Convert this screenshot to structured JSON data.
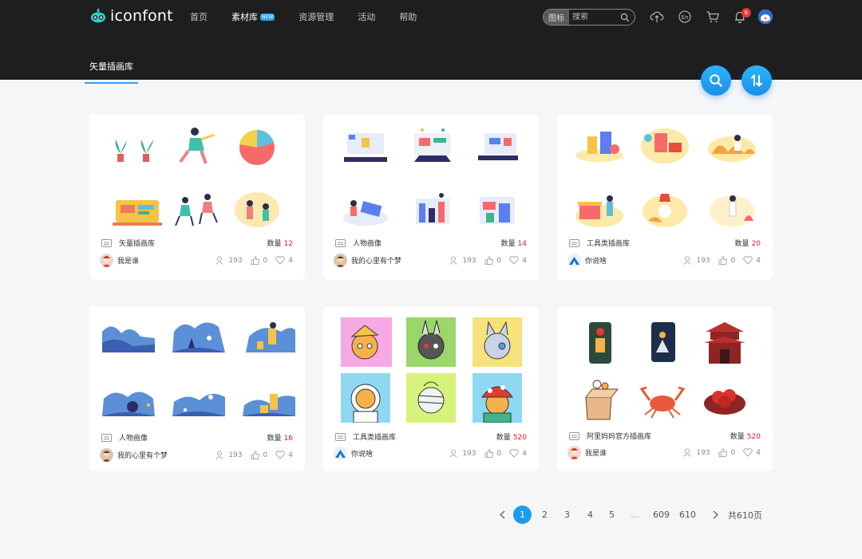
{
  "brand": {
    "name": "iconfont"
  },
  "nav": [
    {
      "label": "首页",
      "active": false
    },
    {
      "label": "素材库",
      "active": true,
      "badge": "NEW"
    },
    {
      "label": "资源管理",
      "active": false
    },
    {
      "label": "活动",
      "active": false
    },
    {
      "label": "帮助",
      "active": false
    }
  ],
  "search": {
    "type": "图标",
    "placeholder": "搜索"
  },
  "notifications": {
    "count": "6"
  },
  "subnav": {
    "label": "矢量插画库"
  },
  "cards": [
    {
      "title": "矢量插画库",
      "count_label": "数量",
      "count": "12",
      "author": "我是谁",
      "views": "193",
      "likes": "0",
      "favs": "4"
    },
    {
      "title": "人物画像",
      "count_label": "数量",
      "count": "14",
      "author": "我的心里有个梦",
      "views": "193",
      "likes": "0",
      "favs": "4"
    },
    {
      "title": "工具类插画库",
      "count_label": "数量",
      "count": "20",
      "author": "你说啥",
      "views": "193",
      "likes": "0",
      "favs": "4"
    },
    {
      "title": "人物画像",
      "count_label": "数量",
      "count": "16",
      "author": "我的心里有个梦",
      "views": "193",
      "likes": "0",
      "favs": "4"
    },
    {
      "title": "工具类插画库",
      "count_label": "数量",
      "count": "520",
      "author": "你说啥",
      "views": "193",
      "likes": "0",
      "favs": "4"
    },
    {
      "title": "阿里妈妈官方插画库",
      "count_label": "数量",
      "count": "520",
      "author": "我是谁",
      "views": "193",
      "likes": "0",
      "favs": "4"
    }
  ],
  "pagination": {
    "pages": [
      "1",
      "2",
      "3",
      "4",
      "5",
      "...",
      "609",
      "610"
    ],
    "current": "1",
    "total_label": "共610页"
  },
  "colors": {
    "accent": "#1a9df0",
    "header_bg": "#1e1e1e",
    "count_red": "#e02020"
  }
}
